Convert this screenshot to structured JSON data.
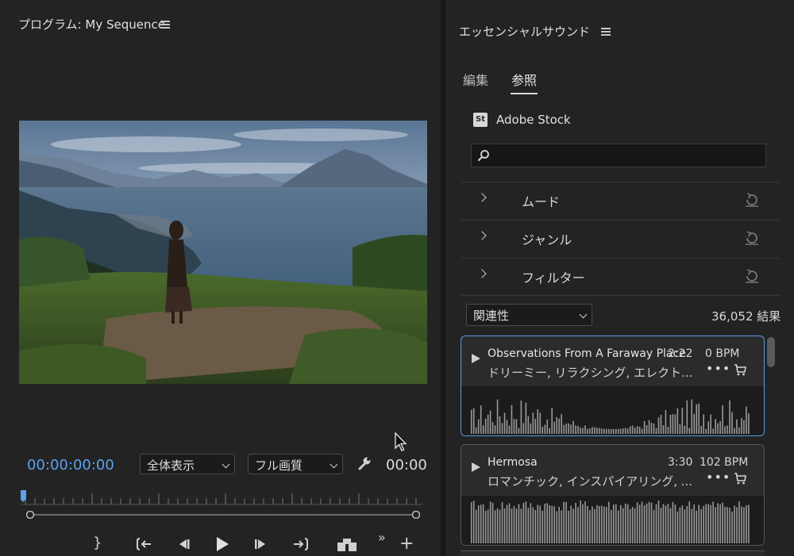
{
  "program": {
    "title": "プログラム: My Sequence",
    "timecode": "00:00:00:00",
    "fit_label": "全体表示",
    "quality_label": "フル画質",
    "tc_right": "00:00"
  },
  "essential_sound": {
    "title": "エッセンシャルサウンド",
    "tabs": [
      "編集",
      "参照"
    ],
    "active_tab": "参照",
    "provider": {
      "logo": "St",
      "name": "Adobe Stock"
    },
    "search_placeholder": "",
    "filters": [
      {
        "label": "ムード"
      },
      {
        "label": "ジャンル"
      },
      {
        "label": "フィルター"
      }
    ],
    "sort_label": "関連性",
    "results_count": "36,052 結果",
    "tracks": [
      {
        "title": "Observations From A Faraway Place",
        "duration": "2:22",
        "bpm": "0 BPM",
        "tags": "ドリーミー, リラクシング, エレクト...",
        "selected": true
      },
      {
        "title": "Hermosa",
        "duration": "3:30",
        "bpm": "102 BPM",
        "tags": "ロマンチック, インスパイアリング, ...",
        "selected": false
      }
    ]
  },
  "colors": {
    "accent": "#5aa2ee",
    "panel_bg": "#232323",
    "selected_border": "#5a9be6"
  },
  "icons": [
    "menu-icon",
    "search-icon",
    "chevron-right-icon",
    "reset-icon",
    "play-icon",
    "more-icon",
    "cart-icon",
    "wrench-icon",
    "mouse-cursor-icon"
  ]
}
